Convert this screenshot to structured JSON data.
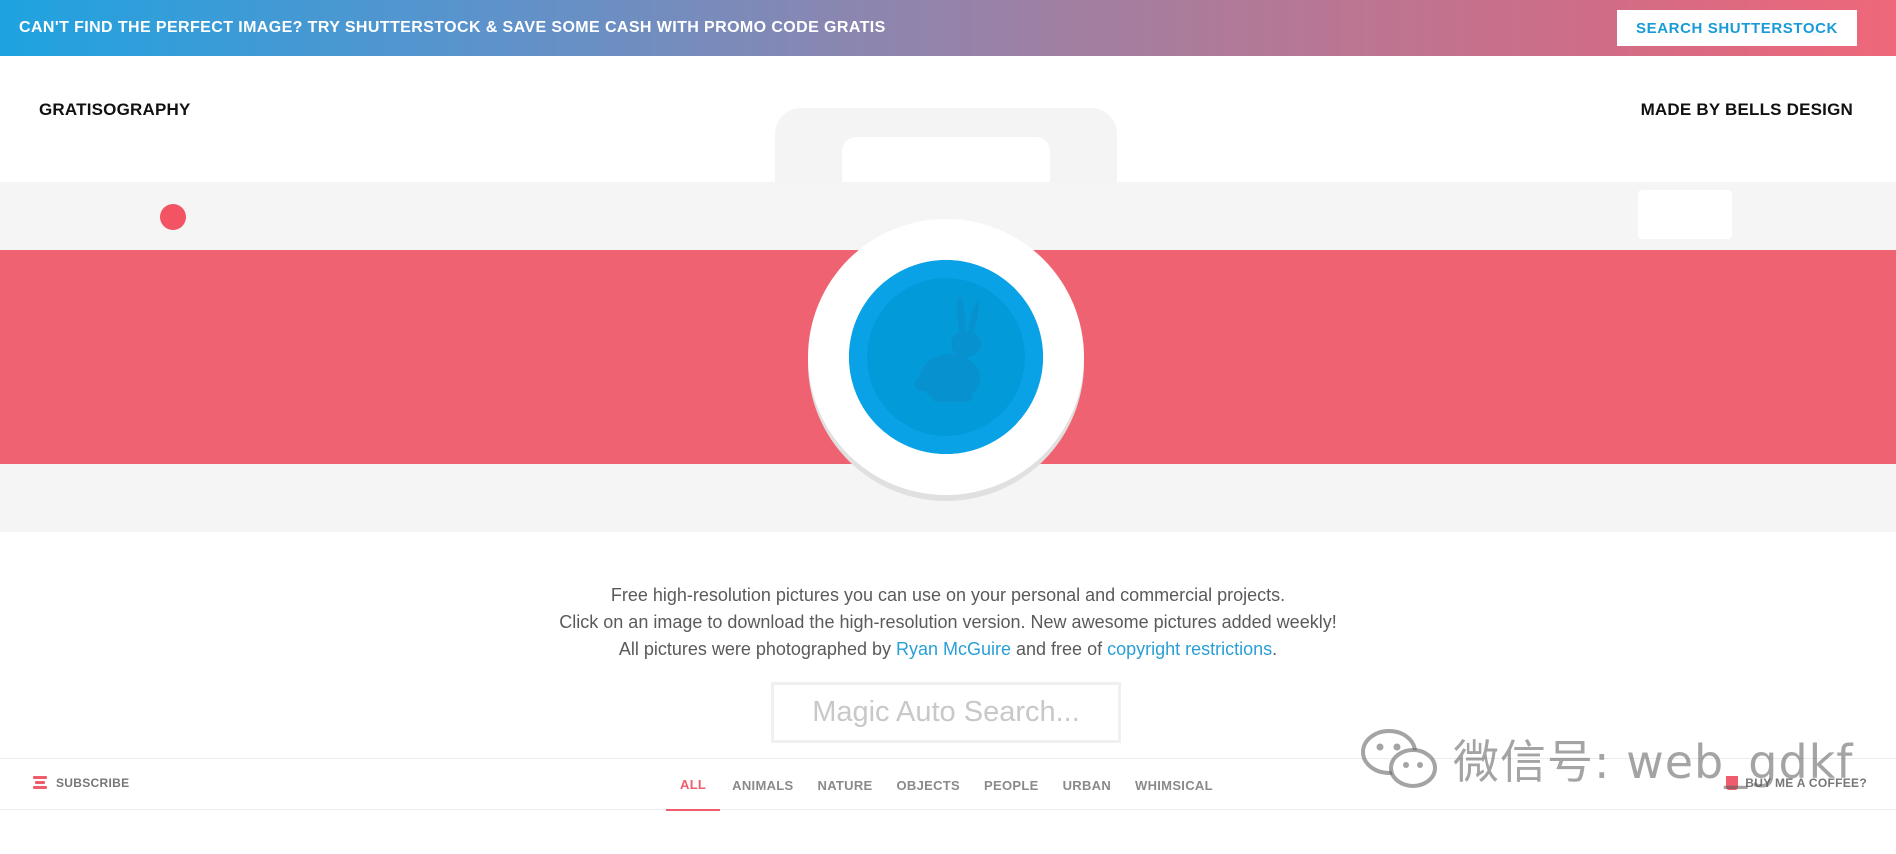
{
  "promo": {
    "text": "CAN'T FIND THE PERFECT IMAGE? TRY SHUTTERSTOCK & SAVE SOME CASH WITH PROMO CODE GRATIS",
    "button_label": "SEARCH SHUTTERSTOCK"
  },
  "header": {
    "brand": "GRATISOGRAPHY",
    "made_by": "MADE BY BELLS DESIGN"
  },
  "tagline": {
    "line1": "Free high-resolution pictures you can use on your personal and commercial projects.",
    "line2": "Click on an image to download the high-resolution version. New awesome pictures added weekly!",
    "line3_prefix": "All pictures were photographed by ",
    "author_link": "Ryan McGuire",
    "line3_middle": " and free of ",
    "copyright_link": "copyright restrictions",
    "line3_suffix": "."
  },
  "search": {
    "placeholder": "Magic Auto Search...",
    "value": ""
  },
  "nav": {
    "subscribe_label": "SUBSCRIBE",
    "categories": [
      {
        "label": "ALL",
        "active": true
      },
      {
        "label": "ANIMALS",
        "active": false
      },
      {
        "label": "NATURE",
        "active": false
      },
      {
        "label": "OBJECTS",
        "active": false
      },
      {
        "label": "PEOPLE",
        "active": false
      },
      {
        "label": "URBAN",
        "active": false
      },
      {
        "label": "WHIMSICAL",
        "active": false
      }
    ],
    "coffee_label": "BUY ME A COFFEE?"
  },
  "watermark": {
    "text": "微信号: web_gdkf"
  },
  "colors": {
    "accent_red": "#ef6272",
    "lens_blue": "#00a0e3",
    "link_blue": "#2a9fd6"
  },
  "icons": {
    "camera_illustration": "camera-icon",
    "lens_rabbit": "rabbit-icon",
    "subscribe": "menu-lines-icon",
    "coffee": "coffee-cup-icon",
    "watermark": "wechat-icon"
  }
}
